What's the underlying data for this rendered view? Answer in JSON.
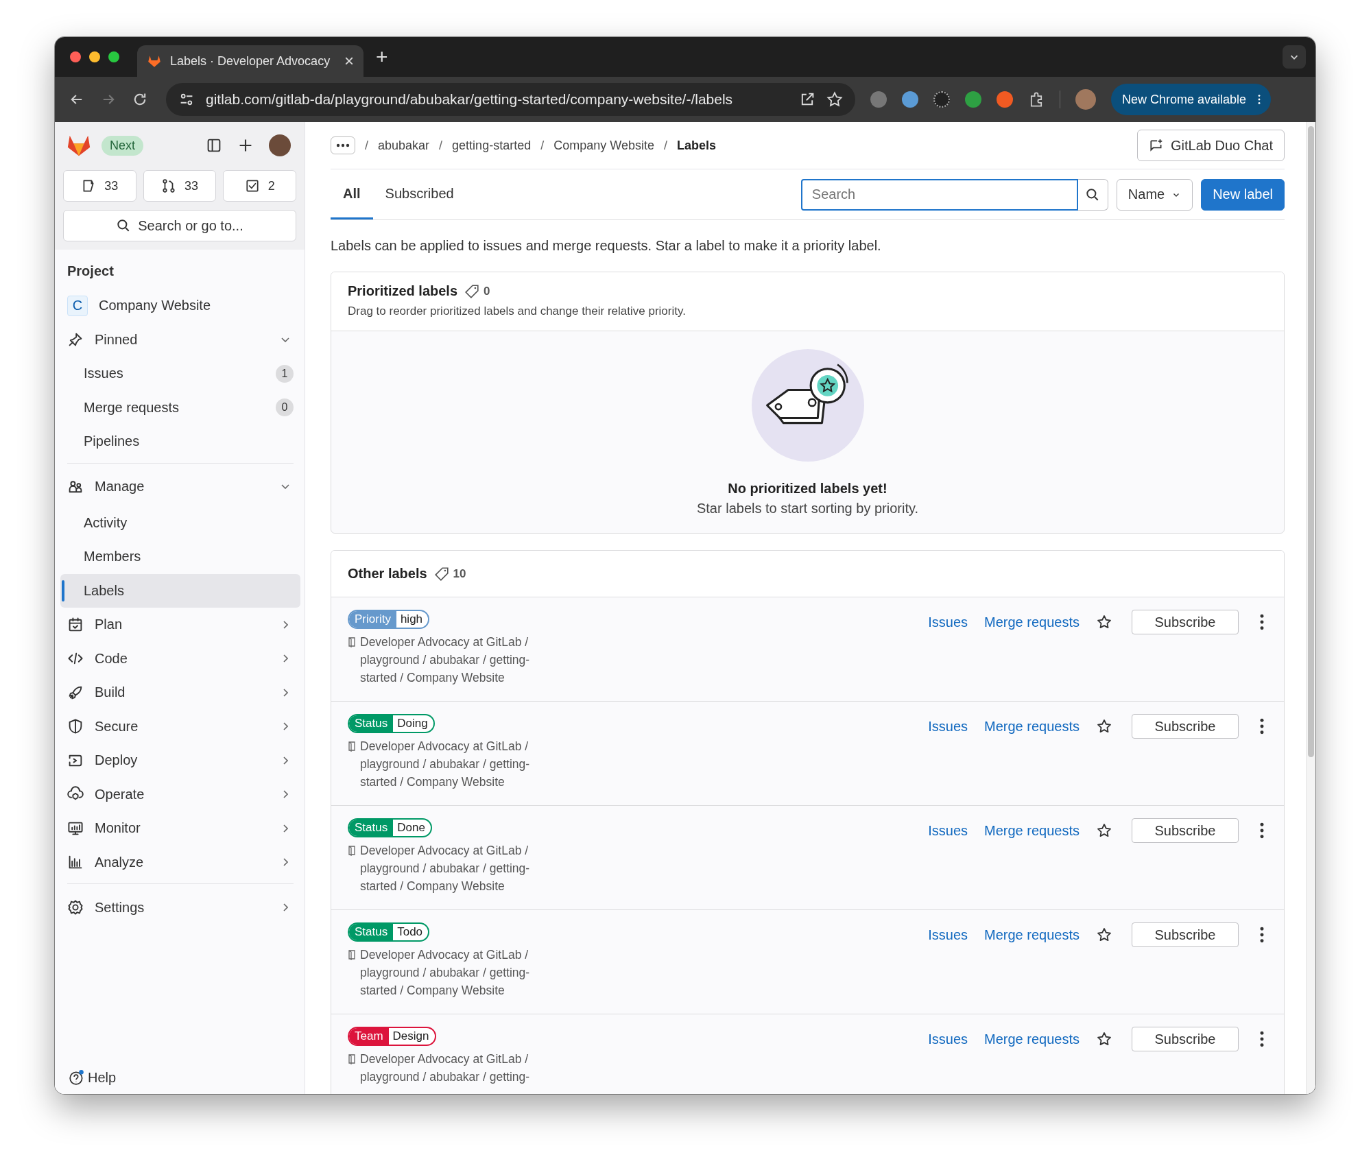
{
  "browser": {
    "tab_title": "Labels · Developer Advocacy",
    "tab_close": "×",
    "new_tab": "+",
    "url": "gitlab.com/gitlab-da/playground/abubakar/getting-started/company-website/-/labels",
    "update_button": "New Chrome available"
  },
  "sidebar": {
    "badge": "Next",
    "counters": [
      {
        "kind": "issues",
        "count": "33"
      },
      {
        "kind": "merge",
        "count": "33"
      },
      {
        "kind": "todo",
        "count": "2"
      }
    ],
    "search": "Search or go to...",
    "section": "Project",
    "project": {
      "initial": "C",
      "name": "Company Website"
    },
    "groups": [
      {
        "kind": "pin",
        "label": "Pinned",
        "expanded": true,
        "separated": false,
        "children": [
          {
            "label": "Issues",
            "count": "1",
            "selected": false
          },
          {
            "label": "Merge requests",
            "count": "0",
            "selected": false
          },
          {
            "label": "Pipelines",
            "selected": false
          }
        ]
      },
      {
        "kind": "manage",
        "label": "Manage",
        "expanded": true,
        "separated": true,
        "children": [
          {
            "label": "Activity",
            "selected": false
          },
          {
            "label": "Members",
            "selected": false
          },
          {
            "label": "Labels",
            "selected": true
          }
        ]
      },
      {
        "kind": "plan",
        "label": "Plan",
        "expanded": false,
        "separated": false
      },
      {
        "kind": "code",
        "label": "Code",
        "expanded": false,
        "separated": false
      },
      {
        "kind": "build",
        "label": "Build",
        "expanded": false,
        "separated": false
      },
      {
        "kind": "secure",
        "label": "Secure",
        "expanded": false,
        "separated": false
      },
      {
        "kind": "deploy",
        "label": "Deploy",
        "expanded": false,
        "separated": false
      },
      {
        "kind": "operate",
        "label": "Operate",
        "expanded": false,
        "separated": false
      },
      {
        "kind": "monitor",
        "label": "Monitor",
        "expanded": false,
        "separated": false
      },
      {
        "kind": "analyze",
        "label": "Analyze",
        "expanded": false,
        "separated": false
      },
      {
        "kind": "settings",
        "label": "Settings",
        "expanded": false,
        "separated": true
      }
    ],
    "help": "Help"
  },
  "breadcrumbs": [
    {
      "separator": "/",
      "label": "abubakar"
    },
    {
      "separator": "/",
      "label": "getting-started"
    },
    {
      "separator": "/",
      "label": "Company Website"
    },
    {
      "separator": "/",
      "label": "Labels"
    }
  ],
  "duo_button": "GitLab Duo Chat",
  "tabs": [
    {
      "label": "All",
      "selected": true
    },
    {
      "label": "Subscribed",
      "selected": false
    }
  ],
  "search": {
    "placeholder": "Search"
  },
  "sort": "Name",
  "new_button": "New label",
  "intro": "Labels can be applied to issues and merge requests. Star a label to make it a priority label.",
  "prioritized": {
    "title": "Prioritized labels",
    "count": "0",
    "description": "Drag to reorder prioritized labels and change their relative priority.",
    "empty_title": "No prioritized labels yet!",
    "empty_text": "Star labels to start sorting by priority."
  },
  "other": {
    "title": "Other labels",
    "count": "10",
    "labels": [
      {
        "scope": "Priority",
        "value": "high",
        "color": "#6699cc",
        "path": "Developer Advocacy at GitLab / playground / abubakar / getting-started / Company Website",
        "issues": "Issues",
        "merge_requests": "Merge requests",
        "starred": false,
        "subscribe": "Subscribe"
      },
      {
        "scope": "Status",
        "value": "Doing",
        "color": "#009966",
        "path": "Developer Advocacy at GitLab / playground / abubakar / getting-started / Company Website",
        "issues": "Issues",
        "merge_requests": "Merge requests",
        "starred": false,
        "subscribe": "Subscribe"
      },
      {
        "scope": "Status",
        "value": "Done",
        "color": "#009966",
        "path": "Developer Advocacy at GitLab / playground / abubakar / getting-started / Company Website",
        "issues": "Issues",
        "merge_requests": "Merge requests",
        "starred": false,
        "subscribe": "Subscribe"
      },
      {
        "scope": "Status",
        "value": "Todo",
        "color": "#009966",
        "path": "Developer Advocacy at GitLab / playground / abubakar / getting-started / Company Website",
        "issues": "Issues",
        "merge_requests": "Merge requests",
        "starred": false,
        "subscribe": "Subscribe"
      },
      {
        "scope": "Team",
        "value": "Design",
        "color": "#dc143c",
        "path": "Developer Advocacy at GitLab / playground / abubakar / getting-",
        "issues": "Issues",
        "merge_requests": "Merge requests",
        "starred": false,
        "subscribe": "Subscribe"
      }
    ]
  }
}
